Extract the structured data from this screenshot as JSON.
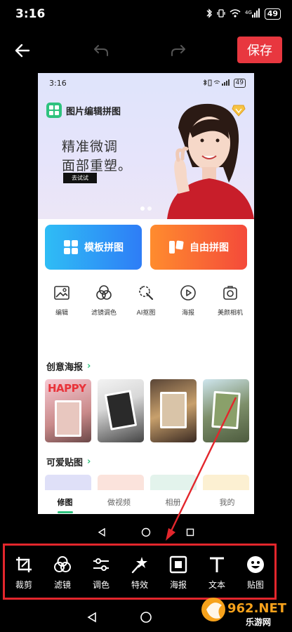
{
  "statusbar": {
    "time": "3:16",
    "battery": "49",
    "network": "4G"
  },
  "toolbar": {
    "save_label": "保存"
  },
  "phone": {
    "status": {
      "time": "3:16",
      "battery": "49"
    },
    "banner": {
      "app_name": "图片编辑拼图",
      "slogan_line1": "精准微调",
      "slogan_line2": "面部重塑。",
      "try_label": "去试试"
    },
    "big_buttons": [
      {
        "label": "模板拼图"
      },
      {
        "label": "自由拼图"
      }
    ],
    "tools": [
      {
        "label": "编辑",
        "icon": "image-icon"
      },
      {
        "label": "滤镜调色",
        "icon": "filter-icon"
      },
      {
        "label": "AI抠图",
        "icon": "magic-wand-icon"
      },
      {
        "label": "海报",
        "icon": "play-icon"
      },
      {
        "label": "美颜相机",
        "icon": "camera-icon"
      }
    ],
    "section_posters": "创意海报",
    "poster_happy_text": "HAPPY",
    "section_stickers": "可爱贴图",
    "tabs": [
      {
        "label": "修图",
        "active": true
      },
      {
        "label": "做视频",
        "active": false
      },
      {
        "label": "相册",
        "active": false
      },
      {
        "label": "我的",
        "active": false
      }
    ]
  },
  "bottom_tools": [
    {
      "label": "裁剪",
      "icon": "crop-icon"
    },
    {
      "label": "滤镜",
      "icon": "filter-icon"
    },
    {
      "label": "调色",
      "icon": "sliders-icon"
    },
    {
      "label": "特效",
      "icon": "magic-icon"
    },
    {
      "label": "海报",
      "icon": "frame-icon"
    },
    {
      "label": "文本",
      "icon": "text-icon"
    },
    {
      "label": "贴图",
      "icon": "sticker-icon"
    }
  ],
  "watermark": {
    "brand": "962.NET",
    "sub": "乐游网"
  },
  "colors": {
    "accent_red": "#e8373f",
    "accent_green": "#2ec27e",
    "highlight": "#e3262c"
  }
}
